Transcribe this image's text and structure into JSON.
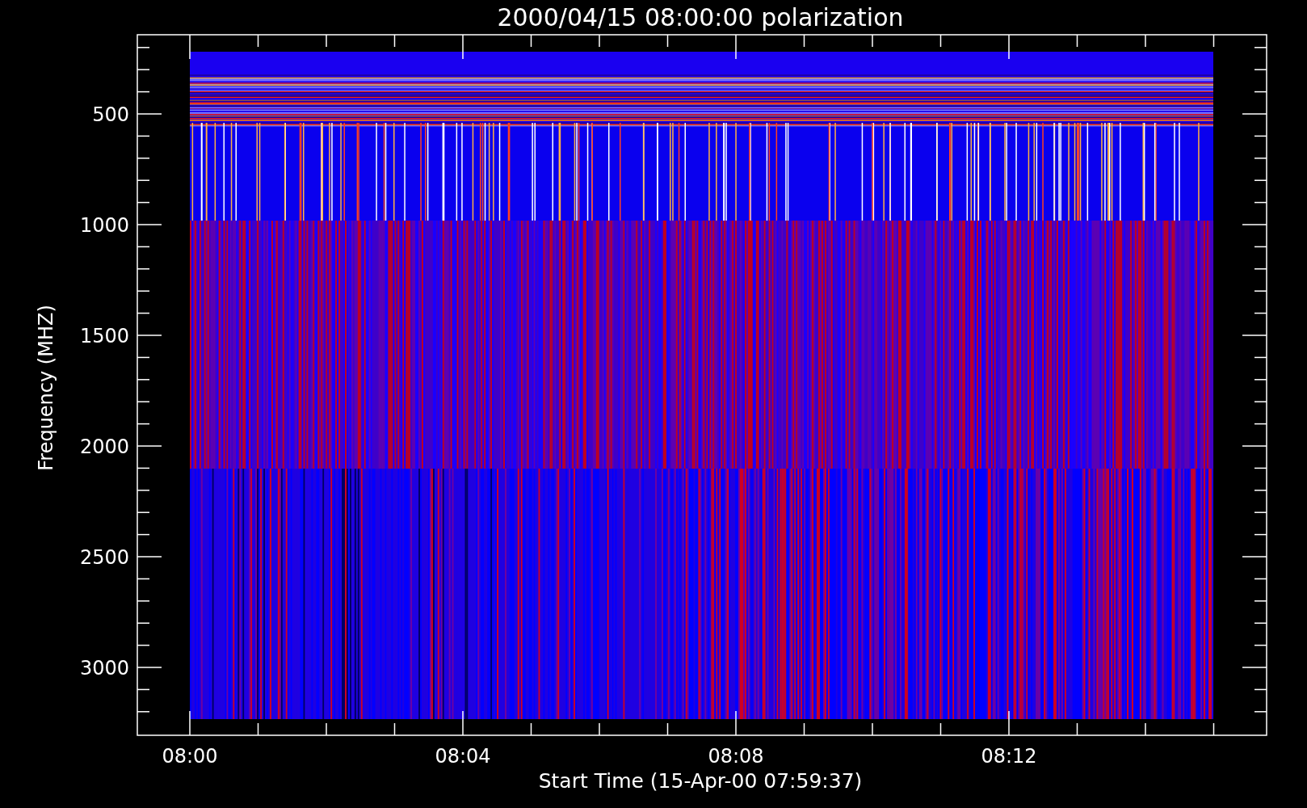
{
  "plot": {
    "title": "2000/04/15 08:00:00 polarization",
    "ylabel": "Frequency (MHZ)",
    "xlabel": "Start Time (15-Apr-00 07:59:37)",
    "yticks": [
      "500",
      "1000",
      "1500",
      "2000",
      "2500",
      "3000"
    ],
    "xticks": [
      "08:00",
      "08:04",
      "08:08",
      "08:12"
    ]
  }
}
